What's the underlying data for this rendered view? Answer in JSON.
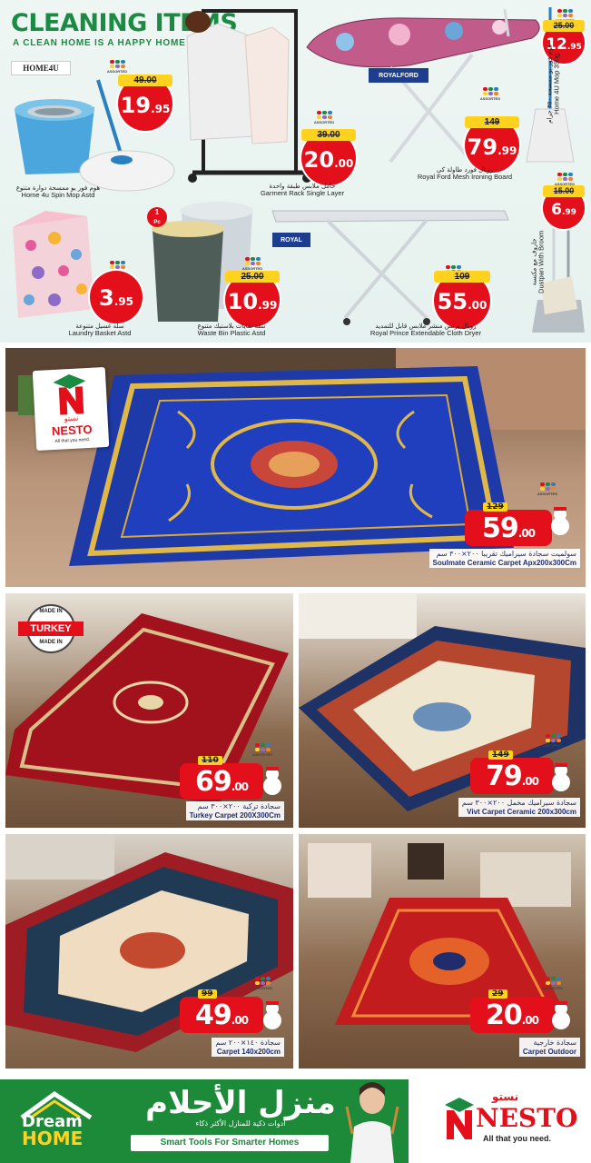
{
  "cleaning": {
    "title": "CLEANING ITEMS",
    "subtitle": "A CLEAN HOME IS A HAPPY HOME",
    "brands": {
      "home4u": "HOME4U",
      "royalford": "ROYALFORD",
      "royal": "ROYAL"
    },
    "assorted_label": "ASSORTED",
    "one_pc": {
      "ar": "حبة",
      "num": "1",
      "unit": "Pc"
    },
    "products": [
      {
        "id": "spin-mop",
        "old_price": "49.00",
        "price_main": "19",
        "price_dec": ".95",
        "en": "Home 4u Spin Mop Astd",
        "ar": "هوم فور يو ممسحة دوارة متنوع"
      },
      {
        "id": "garment-rack",
        "old_price": "39.00",
        "price_main": "20",
        "price_dec": ".00",
        "en": "Garment Rack Single Layer",
        "ar": "حامل ملابس طبقة واحدة"
      },
      {
        "id": "ironing-board",
        "old_price": "149",
        "price_main": "79",
        "price_dec": ".99",
        "en": "Royal Ford Mesh Ironing Board",
        "ar": "رويال فورد طاولة كي"
      },
      {
        "id": "home4u-mop",
        "old_price": "25.00",
        "price_main": "12",
        "price_dec": ".95",
        "en": "Home 4U Mop 350g",
        "ar": "هوم فور يو ممسحة ٣٥٠ جرام"
      },
      {
        "id": "laundry-basket",
        "old_price": "",
        "price_main": "3",
        "price_dec": ".95",
        "en": "Laundry Basket Astd",
        "ar": "سلة غسيل متنوعة"
      },
      {
        "id": "waste-bin",
        "old_price": "25.00",
        "price_main": "10",
        "price_dec": ".99",
        "en": "Waste Bin Plastic Astd",
        "ar": "سلة نفايات بلاستيك متنوع"
      },
      {
        "id": "cloth-dryer",
        "old_price": "109",
        "price_main": "55",
        "price_dec": ".00",
        "en": "Royal Prince Extendable Cloth Dryer",
        "ar": "رويال برنس منشر ملابس قابل للتمديد"
      },
      {
        "id": "dustpan",
        "old_price": "15.00",
        "price_main": "6",
        "price_dec": ".99",
        "en": "Dustpan With Broom",
        "ar": "جاروف مع مكنسة"
      }
    ]
  },
  "carpets": {
    "nesto_sign": {
      "ar": "نستو",
      "en": "NESTO",
      "tagline": "All that you need."
    },
    "turkey_badge": {
      "top": "MADE IN",
      "middle": "TURKEY",
      "bottom": "MADE IN"
    },
    "items": [
      {
        "id": "soulmate",
        "old_price": "129",
        "price_main": "59",
        "price_dec": ".00",
        "en": "Soulmate Ceramic Carpet  Apx200x300Cm",
        "ar": "سولميت سجادة سيراميك تقريبا ٢٠٠×٣٠٠ سم"
      },
      {
        "id": "turkey",
        "old_price": "110",
        "price_main": "69",
        "price_dec": ".00",
        "en": "Turkey Carpet 200X300Cm",
        "ar": "سجادة تركية ٢٠٠×٣٠٠ سم"
      },
      {
        "id": "vivt",
        "old_price": "149",
        "price_main": "79",
        "price_dec": ".00",
        "en": "Vivt Carpet Ceramic 200x300cm",
        "ar": "سجادة سيراميك مخمل ٢٠٠×٣٠٠ سم"
      },
      {
        "id": "carpet-140",
        "old_price": "99",
        "price_main": "49",
        "price_dec": ".00",
        "en": "Carpet 140x200cm",
        "ar": "سجادة ١٤٠×٢٠٠ سم"
      },
      {
        "id": "outdoor",
        "old_price": "29",
        "price_main": "20",
        "price_dec": ".00",
        "en": "Carpet Outdoor",
        "ar": "سجادة خارجية"
      }
    ]
  },
  "footer": {
    "dream": "Dream",
    "home": "HOME",
    "ar_title": "منزل الأحلام",
    "ar_sub": "أدوات ذكية للمنازل الأكثر ذكاء",
    "tagline": "Smart Tools For Smarter Homes",
    "nesto_ar": "نستو",
    "nesto_en": "NESTO",
    "nesto_tag": "All that you need."
  },
  "colors": {
    "red": "#e3101c",
    "yellow": "#ffd21f",
    "green": "#1b8a43",
    "navy": "#1f2d6d"
  }
}
